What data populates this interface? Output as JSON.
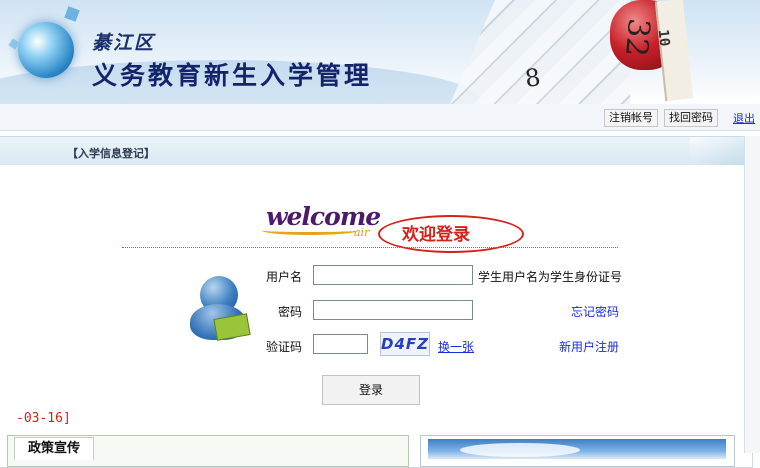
{
  "header": {
    "district": "綦江区",
    "title": "义务教育新生入学管理",
    "tape_number_large": "32",
    "tape_number_small": "8",
    "tape_number_side": "10"
  },
  "topbar": {
    "cancel_account": "注销帐号",
    "recover_password": "找回密码",
    "logout": "退出"
  },
  "panel": {
    "title": "【入学信息登记】"
  },
  "welcome": {
    "word": "welcome",
    "sub": "air",
    "text": "欢迎登录"
  },
  "form": {
    "username_label": "用户名",
    "username_value": "",
    "username_hint": "学生用户名为学生身份证号",
    "password_label": "密码",
    "password_value": "",
    "forgot_password": "忘记密码",
    "captcha_label": "验证码",
    "captcha_value": "",
    "captcha_image_text": "D4FZ",
    "refresh_captcha": "换一张",
    "register": "新用户注册",
    "login_button": "登录"
  },
  "bottom": {
    "date_fragment": "-03-16]",
    "policy_tab": "政策宣传"
  },
  "colors": {
    "header_title": "#14246b",
    "welcome_red": "#d4211a",
    "link_blue": "#1a2edc"
  }
}
